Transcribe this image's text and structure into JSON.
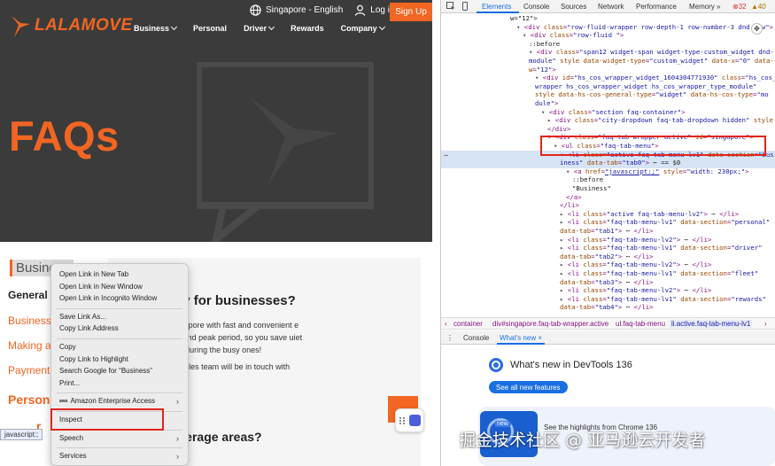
{
  "site": {
    "logo_text": "LALAMOVE",
    "region_label": "Singapore - English",
    "login_label": "Log in",
    "signup_label": "Sign Up",
    "nav": [
      {
        "label": "Business",
        "dropdown": true
      },
      {
        "label": "Personal",
        "dropdown": false
      },
      {
        "label": "Driver",
        "dropdown": true
      },
      {
        "label": "Rewards",
        "dropdown": false
      },
      {
        "label": "Company",
        "dropdown": true
      }
    ],
    "hero_title": "FAQs",
    "tab_heading": "Business",
    "side_links": [
      "General",
      "Business",
      "Making a",
      "Payment",
      "Person",
      "r"
    ],
    "question_1": "move do delivery for businesses?",
    "answer_1": "businesses of all sizes in Singapore with fast and convenient e to your needs through the lull and peak period, so you save uiet seasons, and fulfil more order during the busy ones!",
    "answer_2": "our friendly and professional sales team will be in touch with",
    "question_2": "the service coverage areas?",
    "status_url": "javascript:;",
    "brand_color": "#f16622"
  },
  "context_menu": {
    "groups": [
      [
        "Open Link in New Tab",
        "Open Link in New Window",
        "Open Link in Incognito Window"
      ],
      [
        "Save Link As...",
        "Copy Link Address"
      ],
      [
        "Copy",
        "Copy Link to Highlight",
        "Search Google for “Business”",
        "Print..."
      ],
      [
        "Amazon Enterprise Access"
      ],
      [
        "Inspect"
      ],
      [
        "Speech"
      ],
      [
        "Services"
      ]
    ],
    "highlighted": "Inspect"
  },
  "devtools": {
    "tabs": [
      "Elements",
      "Console",
      "Sources",
      "Network",
      "Performance",
      "Memory"
    ],
    "active_tab": "Elements",
    "error_count": "32",
    "warning_count": "40",
    "dom_lines": [
      {
        "indent": 0,
        "tri": "",
        "tag": "w=\"12\">",
        "plain": true
      },
      {
        "indent": 1,
        "tri": "▾",
        "html": "<span class='tag'>&lt;div </span><span class='an'>class</span>=<span class='av'>\"row-fluid-wrapper row-depth-1 row-number-3 dnd-row\"</span><span class='tag'>&gt;</span>"
      },
      {
        "indent": 2,
        "tri": "▾",
        "html": "<span class='tag'>&lt;div </span><span class='an'>class</span>=<span class='av'>\"row-fluid \"</span><span class='tag'>&gt;</span>"
      },
      {
        "indent": 3,
        "tri": "",
        "html": "<span class='tx'>::before</span>"
      },
      {
        "indent": 3,
        "tri": "▾",
        "html": "<span class='tag'>&lt;div </span><span class='an'>class</span>=<span class='av'>\"span12 widget-span widget-type-custom_widget dnd-</span>"
      },
      {
        "indent": 3,
        "tri": "",
        "html": "<span class='av'>module\"</span> <span class='an'>style</span> <span class='an'>data-widget-type</span>=<span class='av'>\"custom_widget\"</span> <span class='an'>data-x</span>=<span class='av'>\"0\"</span> <span class='an'>data-</span>"
      },
      {
        "indent": 3,
        "tri": "",
        "html": "<span class='an'>w</span>=<span class='av'>\"12\"</span><span class='tag'>&gt;</span>"
      },
      {
        "indent": 4,
        "tri": "▾",
        "html": "<span class='tag'>&lt;div </span><span class='an'>id</span>=<span class='av'>\"hs_cos_wrapper_widget_1604304771930\"</span> <span class='an'>class</span>=<span class='av'>\"hs_cos_</span>"
      },
      {
        "indent": 4,
        "tri": "",
        "html": "<span class='av'>wrapper hs_cos_wrapper_widget hs_cos_wrapper_type_module\"</span>"
      },
      {
        "indent": 4,
        "tri": "",
        "html": "<span class='an'>style</span> <span class='an'>data-hs-cos-general-type</span>=<span class='av'>\"widget\"</span> <span class='an'>data-hs-cos-type</span>=<span class='av'>\"mo</span>"
      },
      {
        "indent": 4,
        "tri": "",
        "html": "<span class='av'>dule\"</span><span class='tag'>&gt;</span>"
      },
      {
        "indent": 5,
        "tri": "▾",
        "html": "<span class='tag'>&lt;div </span><span class='an'>class</span>=<span class='av'>\"section faq-container\"</span><span class='tag'>&gt;</span>"
      },
      {
        "indent": 6,
        "tri": "▸",
        "html": "<span class='tag'>&lt;div </span><span class='an'>class</span>=<span class='av'>\"city-dropdown faq-tab-dropdown hidden\"</span> <span class='an'>style</span>"
      },
      {
        "indent": 6,
        "tri": "",
        "html": "<span class='tag'>&lt;/div&gt;</span>"
      },
      {
        "indent": 6,
        "tri": "▾",
        "html": "<span class='tag'>&lt;div </span><span class='an'>class</span>=<span class='av'>\"faq-tab-wrapper active\"</span> <span class='an'>id</span>=<span class='av'>\"singapore\"</span><span class='tag'>&gt;</span>"
      },
      {
        "indent": 7,
        "tri": "▾",
        "html": "<span class='tag'>&lt;ul </span><span class='an'>class</span>=<span class='av'>\"faq-tab-menu\"</span><span class='tag'>&gt;</span>"
      },
      {
        "indent": 8,
        "tri": "▾",
        "html": "<span class='tag'>&lt;li </span><span class='an'>class</span>=<span class='av'>\"active faq-tab-menu-lv1\"</span> <span class='an'>data-section</span>=<span class='av'>\"bus</span>"
      },
      {
        "indent": 8,
        "tri": "",
        "html": "<span class='av'>iness\"</span> <span class='an'>data-tab</span>=<span class='av'>\"tab0\"</span><span class='tag'>&gt;</span> <span class='tx'>⋯ == $0</span>"
      },
      {
        "indent": 9,
        "tri": "▾",
        "html": "<span class='tag'>&lt;a </span><span class='an'>href</span>=<span class='av' style='text-decoration:underline'>\"javascript:;\"</span> <span class='an'>style</span>=<span class='av'>\"width: 230px;\"</span><span class='tag'>&gt;</span>"
      },
      {
        "indent": 10,
        "tri": "",
        "html": "<span class='tx'>::before</span>"
      },
      {
        "indent": 10,
        "tri": "",
        "html": "<span class='tx'>\"Business\"</span>"
      },
      {
        "indent": 9,
        "tri": "",
        "html": "<span class='tag'>&lt;/a&gt;</span>"
      },
      {
        "indent": 8,
        "tri": "",
        "html": "<span class='tag'>&lt;/li&gt;</span>"
      },
      {
        "indent": 8,
        "tri": "▸",
        "html": "<span class='tag'>&lt;li </span><span class='an'>class</span>=<span class='av'>\"active faq-tab-menu-lv2\"</span><span class='tag'>&gt;</span> <span class='tx'>⋯</span> <span class='tag'>&lt;/li&gt;</span>"
      },
      {
        "indent": 8,
        "tri": "▸",
        "html": "<span class='tag'>&lt;li </span><span class='an'>class</span>=<span class='av'>\"faq-tab-menu-lv1\"</span> <span class='an'>data-section</span>=<span class='av'>\"personal\"</span>"
      },
      {
        "indent": 8,
        "tri": "",
        "html": "<span class='an'>data-tab</span>=<span class='av'>\"tab1\"</span><span class='tag'>&gt;</span> <span class='tx'>⋯</span> <span class='tag'>&lt;/li&gt;</span>"
      },
      {
        "indent": 8,
        "tri": "▸",
        "html": "<span class='tag'>&lt;li </span><span class='an'>class</span>=<span class='av'>\"faq-tab-menu-lv2\"</span><span class='tag'>&gt;</span> <span class='tx'>⋯</span> <span class='tag'>&lt;/li&gt;</span>"
      },
      {
        "indent": 8,
        "tri": "▸",
        "html": "<span class='tag'>&lt;li </span><span class='an'>class</span>=<span class='av'>\"faq-tab-menu-lv1\"</span> <span class='an'>data-section</span>=<span class='av'>\"driver\"</span>"
      },
      {
        "indent": 8,
        "tri": "",
        "html": "<span class='an'>data-tab</span>=<span class='av'>\"tab2\"</span><span class='tag'>&gt;</span> <span class='tx'>⋯</span> <span class='tag'>&lt;/li&gt;</span>"
      },
      {
        "indent": 8,
        "tri": "▸",
        "html": "<span class='tag'>&lt;li </span><span class='an'>class</span>=<span class='av'>\"faq-tab-menu-lv2\"</span><span class='tag'>&gt;</span> <span class='tx'>⋯</span> <span class='tag'>&lt;/li&gt;</span>"
      },
      {
        "indent": 8,
        "tri": "▸",
        "html": "<span class='tag'>&lt;li </span><span class='an'>class</span>=<span class='av'>\"faq-tab-menu-lv1\"</span> <span class='an'>data-section</span>=<span class='av'>\"fleet\"</span>"
      },
      {
        "indent": 8,
        "tri": "",
        "html": "<span class='an'>data-tab</span>=<span class='av'>\"tab3\"</span><span class='tag'>&gt;</span> <span class='tx'>⋯</span> <span class='tag'>&lt;/li&gt;</span>"
      },
      {
        "indent": 8,
        "tri": "▸",
        "html": "<span class='tag'>&lt;li </span><span class='an'>class</span>=<span class='av'>\"faq-tab-menu-lv2\"</span><span class='tag'>&gt;</span> <span class='tx'>⋯</span> <span class='tag'>&lt;/li&gt;</span>"
      },
      {
        "indent": 8,
        "tri": "▸",
        "html": "<span class='tag'>&lt;li </span><span class='an'>class</span>=<span class='av'>\"faq-tab-menu-lv1\"</span> <span class='an'>data-section</span>=<span class='av'>\"rewards\"</span>"
      },
      {
        "indent": 8,
        "tri": "",
        "html": "<span class='an'>data-tab</span>=<span class='av'>\"tab4\"</span><span class='tag'>&gt;</span> <span class='tx'>⋯</span> <span class='tag'>&lt;/li&gt;</span>"
      }
    ],
    "breadcrumbs": [
      "container",
      "div#singapore.faq-tab-wrapper.active",
      "ul.faq-tab-menu",
      "li.active.faq-tab-menu-lv1"
    ],
    "drawer_tabs": [
      "Console",
      "What's new"
    ],
    "drawer_active": "What's new",
    "whats_new_title": "What's new in DevTools 136",
    "whats_new_button": "See all new features",
    "thumb_badge": "new",
    "highlights_text": "See the highlights from Chrome 136",
    "accent_color": "#1a6fe0"
  },
  "watermark": "掘金技术社区 @ 亚马逊云开发者"
}
